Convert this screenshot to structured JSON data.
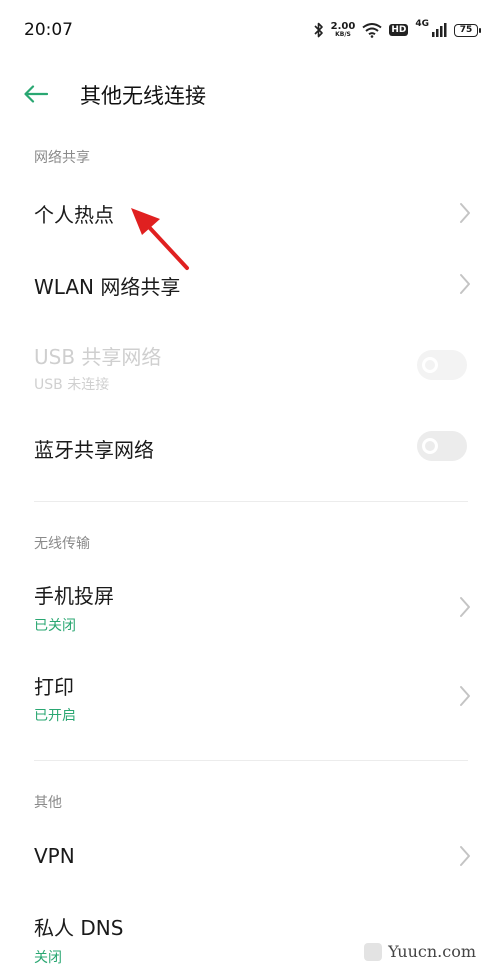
{
  "status_bar": {
    "time": "20:07",
    "speed_value": "2.00",
    "speed_unit": "KB/S",
    "hd": "HD",
    "network": "4G",
    "battery": "75"
  },
  "header": {
    "title": "其他无线连接"
  },
  "sections": {
    "network_sharing": {
      "header": "网络共享",
      "hotspot": "个人热点",
      "wlan_sharing": "WLAN 网络共享",
      "usb_sharing": "USB 共享网络",
      "usb_sub": "USB 未连接",
      "bt_sharing": "蓝牙共享网络"
    },
    "wireless_transfer": {
      "header": "无线传输",
      "cast": "手机投屏",
      "cast_status": "已关闭",
      "print": "打印",
      "print_status": "已开启"
    },
    "other": {
      "header": "其他",
      "vpn": "VPN",
      "dns": "私人 DNS",
      "dns_status": "关闭"
    }
  },
  "watermark": {
    "text": "Yuucn.com"
  },
  "colors": {
    "accent": "#2aa772",
    "annotation_arrow": "#e02020"
  }
}
